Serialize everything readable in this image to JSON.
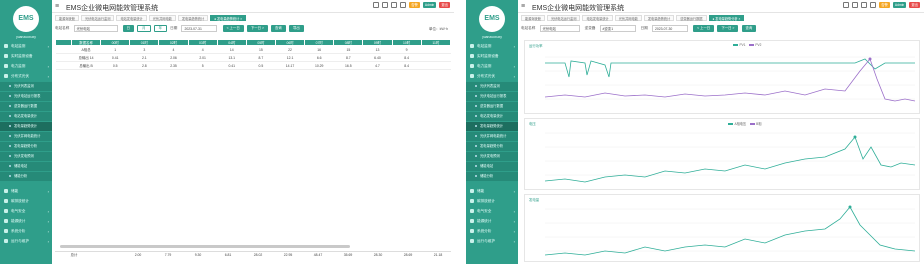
{
  "app_title": "EMS企业微电网能效管理系统",
  "logo_text": "EMS",
  "user_name": "yuanzuoxuxy",
  "header_badges": [
    {
      "text": "告警",
      "color": "#f5a623"
    },
    {
      "text": "Admin",
      "color": "#2f9e8a"
    },
    {
      "text": "退出",
      "color": "#e84a4a"
    }
  ],
  "left": {
    "menu_top": [
      {
        "label": "电站监测",
        "has_chevron": true
      },
      {
        "label": "实时监测设备",
        "has_chevron": false
      },
      {
        "label": "电力监测",
        "has_chevron": true
      },
      {
        "label": "分布式光伏",
        "has_chevron": true
      }
    ],
    "submenu": [
      {
        "label": "光伏列表监测",
        "active": false
      },
      {
        "label": "光伏电站运行报表",
        "active": false
      },
      {
        "label": "逆变器运行数据",
        "active": false
      },
      {
        "label": "电站发电量统计",
        "active": false
      },
      {
        "label": "发电量趋势统计",
        "active": true
      },
      {
        "label": "光伏并网电能统计",
        "active": false
      },
      {
        "label": "发电量趋势分析",
        "active": false
      },
      {
        "label": "光伏发电预测",
        "active": false
      },
      {
        "label": "储能电站",
        "active": false
      },
      {
        "label": "储能分析",
        "active": false
      }
    ],
    "menu_bottom": [
      {
        "label": "储能",
        "has_chevron": true
      },
      {
        "label": "碳排放统计",
        "has_chevron": false
      },
      {
        "label": "电气安全",
        "has_chevron": true
      },
      {
        "label": "能源统计",
        "has_chevron": true
      },
      {
        "label": "系统分析",
        "has_chevron": true
      },
      {
        "label": "运行与维护",
        "has_chevron": true
      }
    ],
    "tabs": [
      {
        "label": "能源驾驶舱",
        "active": false
      },
      {
        "label": "光伏电站运行监测",
        "active": false
      },
      {
        "label": "电站发电量统计",
        "active": false
      },
      {
        "label": "光伏并网电能",
        "active": false
      },
      {
        "label": "发电量趋势统计",
        "active": false
      },
      {
        "label": "● 发电量趋势统计 ×",
        "active": true
      }
    ],
    "filter": {
      "station_label": "电站名称",
      "station_value": "光伏电站",
      "period_buttons": [
        "日",
        "月",
        "年"
      ],
      "date_label": "日期",
      "date_value": "2023-07-31",
      "prev_label": "< 上一日",
      "next_label": "下一日 >",
      "query_label": "查询",
      "export_label": "导出",
      "unit_label": "单位：kW·h"
    },
    "table": {
      "headers": [
        "",
        "数据名称",
        "00时",
        "01时",
        "02时",
        "03时",
        "04时",
        "05时",
        "06时",
        "07时",
        "08时",
        "09时",
        "10时",
        "11时"
      ],
      "rows": [
        [
          "",
          "A相总",
          "1",
          "3",
          "4",
          "4",
          "14",
          "15",
          "22",
          "16",
          "15",
          "13",
          "9",
          ""
        ],
        [
          "",
          "总输出 14",
          "0.41",
          "2.1",
          "2.06",
          "2.01",
          "13.1",
          "8.7",
          "12.1",
          "6.6",
          "8.7",
          "6.40",
          "8.4",
          ""
        ],
        [
          "",
          "总输出 B",
          "0.5",
          "2.8",
          "2.35",
          "5",
          "0.41",
          "0.5",
          "14.17",
          "10.29",
          "16.5",
          "4.7",
          "8.4",
          ""
        ]
      ],
      "total": [
        "总计",
        "",
        "2.00",
        "7.79",
        "9.30",
        "6.81",
        "28.02",
        "22.95",
        "48.47",
        "35.69",
        "28.30",
        "28.69",
        "21.18"
      ]
    }
  },
  "right": {
    "tabs": [
      {
        "label": "能源驾驶舱",
        "active": false
      },
      {
        "label": "光伏电站运行监测",
        "active": false
      },
      {
        "label": "电站发电量统计",
        "active": false
      },
      {
        "label": "光伏并网电能",
        "active": false
      },
      {
        "label": "发电量趋势统计",
        "active": false
      },
      {
        "label": "逆变器运行数据",
        "active": false
      },
      {
        "label": "● 发电量趋势分析 ×",
        "active": true
      }
    ],
    "filter": {
      "station_label": "电站名称",
      "station_value": "光伏电站",
      "device_label": "逆变器",
      "device_value": "#逆变1",
      "date_label": "日期",
      "date_value": "2023-07-30",
      "prev_label": "< 上一日",
      "next_label": "下一日 >",
      "query_label": "查询"
    },
    "charts": [
      {
        "title": "运行功率",
        "legend": [
          "PV1",
          "PV2"
        ],
        "series_colors": [
          "#2fae98",
          "#9b6fc9"
        ]
      },
      {
        "title": "电压",
        "legend": [
          "A相电压",
          "B相"
        ],
        "series_colors": [
          "#2fae98",
          "#9b6fc9"
        ]
      },
      {
        "title": "发电量",
        "legend": [],
        "series_colors": [
          "#2fae98"
        ]
      }
    ]
  }
}
